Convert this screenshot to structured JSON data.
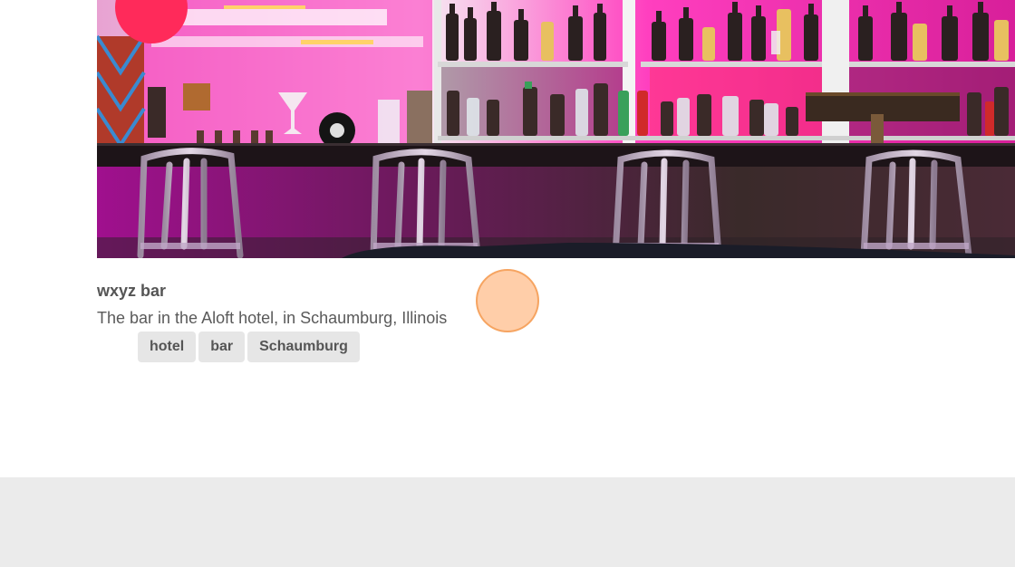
{
  "photo": {
    "icon": "bar-photo-image",
    "accent_colors": [
      "#ff1fb4",
      "#c21ca0",
      "#2a1a1a",
      "#ff2a5a"
    ]
  },
  "caption": {
    "title": "wxyz bar",
    "description": "The bar in the Aloft hotel, in Schaumburg, Illinois"
  },
  "tags": [
    "hotel",
    "bar",
    "Schaumburg"
  ],
  "colors": {
    "footer_band": "#ebebeb",
    "tag_bg": "#e6e6e6",
    "text": "#555555",
    "click_indicator": "#ffbe8c"
  }
}
